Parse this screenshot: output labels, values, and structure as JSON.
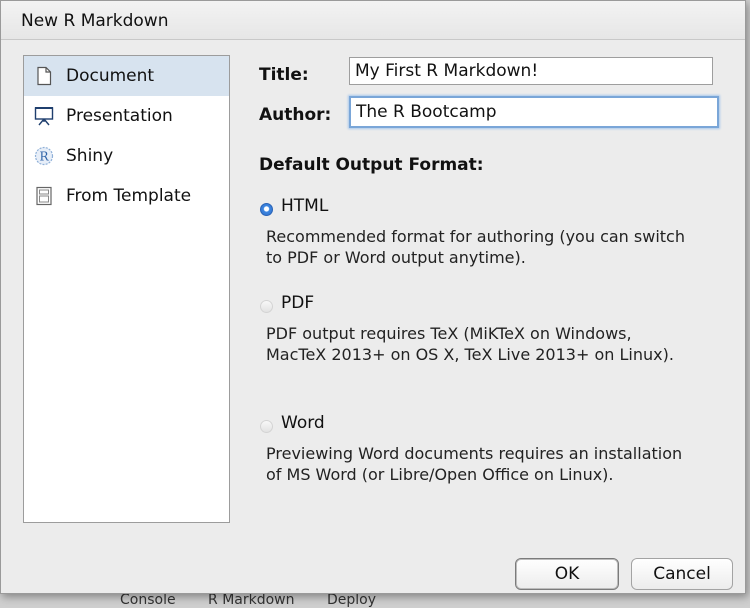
{
  "window": {
    "title": "New R Markdown"
  },
  "sidebar": {
    "items": [
      {
        "label": "Document",
        "icon": "document-icon",
        "selected": true
      },
      {
        "label": "Presentation",
        "icon": "presentation-easel-icon",
        "selected": false
      },
      {
        "label": "Shiny",
        "icon": "shiny-r-icon",
        "selected": false
      },
      {
        "label": "From Template",
        "icon": "template-icon",
        "selected": false
      }
    ]
  },
  "form": {
    "title_label": "Title:",
    "title_value": "My First R Markdown!",
    "author_label": "Author:",
    "author_value": "The R Bootcamp"
  },
  "output_format": {
    "heading": "Default Output Format:",
    "selected": "HTML",
    "options": [
      {
        "label": "HTML",
        "description": "Recommended format for authoring (you can switch to PDF or Word output anytime)."
      },
      {
        "label": "PDF",
        "description": "PDF output requires TeX (MiKTeX on Windows, MacTeX 2013+ on OS X, TeX Live 2013+ on Linux)."
      },
      {
        "label": "Word",
        "description": "Previewing Word documents requires an installation of MS Word (or Libre/Open Office on Linux)."
      }
    ]
  },
  "buttons": {
    "ok": "OK",
    "cancel": "Cancel"
  },
  "background_window": {
    "tabs": [
      "Console",
      "R Markdown",
      "Deploy"
    ]
  },
  "colors": {
    "selection": "#d7e3ef",
    "focus_ring": "#7aa6d8",
    "radio_selected": "#3d86e0"
  }
}
